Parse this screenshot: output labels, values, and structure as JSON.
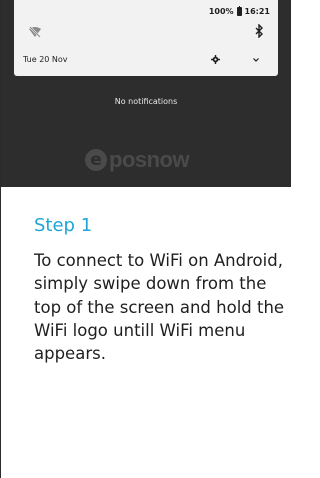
{
  "status_bar": {
    "battery_text": "100%",
    "time": "16:21"
  },
  "quick_panel": {
    "date": "Tue 20 Nov",
    "icons": [
      "wifi-off-icon",
      "bluetooth-icon",
      "settings-icon",
      "expand-icon",
      "battery-icon"
    ]
  },
  "notifications": {
    "empty_text": "No notifications"
  },
  "brand": {
    "mark": "e",
    "name": "posnow"
  },
  "step": {
    "title": "Step 1",
    "body": "To connect to WiFi on Android, simply swipe down from the top of the screen and hold the WiFi logo untill WiFi menu appears."
  },
  "colors": {
    "accent": "#1ea6d8",
    "screen_bg": "#2d2d2d",
    "panel_bg": "#f2f2f2",
    "logo_gray": "#4a4a4a"
  }
}
